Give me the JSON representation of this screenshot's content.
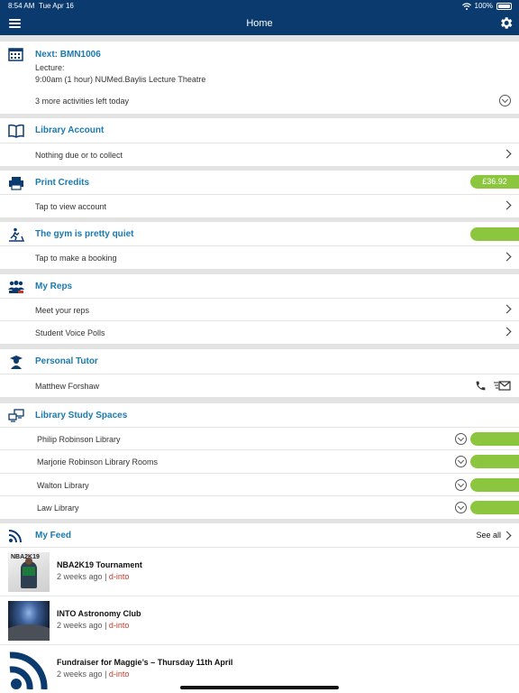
{
  "status_bar": {
    "time": "8:54 AM",
    "date": "Tue Apr 16",
    "battery": "100%"
  },
  "nav": {
    "title": "Home",
    "menu_icon": "hamburger-icon",
    "settings_icon": "gear-icon"
  },
  "next": {
    "title": "Next: BMN1006",
    "type": "Lecture:",
    "detail": "9:00am (1 hour) NUMed.Baylis Lecture Theatre",
    "more": "3 more activities left today"
  },
  "library_account": {
    "title": "Library Account",
    "row": "Nothing due or to collect"
  },
  "print_credits": {
    "title": "Print Credits",
    "balance": "£36.92",
    "row": "Tap to view account"
  },
  "gym": {
    "title": "The gym is pretty quiet",
    "row": "Tap to make a booking"
  },
  "reps": {
    "title": "My Reps",
    "rows": [
      "Meet your reps",
      "Student Voice Polls"
    ]
  },
  "tutor": {
    "title": "Personal Tutor",
    "name": "Matthew Forshaw"
  },
  "study_spaces": {
    "title": "Library Study Spaces",
    "rows": [
      "Philip Robinson Library",
      "Marjorie Robinson Library Rooms",
      "Walton Library",
      "Law Library"
    ]
  },
  "feed": {
    "title": "My Feed",
    "see_all": "See all",
    "items": [
      {
        "title": "NBA2K19 Tournament",
        "time": "2 weeks ago",
        "sep": "|",
        "source": "d-into",
        "thumb_text": "NBA2K19"
      },
      {
        "title": "INTO Astronomy Club",
        "time": "2 weeks ago",
        "sep": "|",
        "source": "d-into"
      },
      {
        "title": "Fundraiser for Maggie’s – Thursday 11th April",
        "time": "2 weeks ago",
        "sep": "|",
        "source": "d-into"
      }
    ]
  },
  "colors": {
    "nav": "#0b3b6e",
    "accent": "#1a7ab0",
    "green": "#8cc63f",
    "link_red": "#c0392b"
  }
}
